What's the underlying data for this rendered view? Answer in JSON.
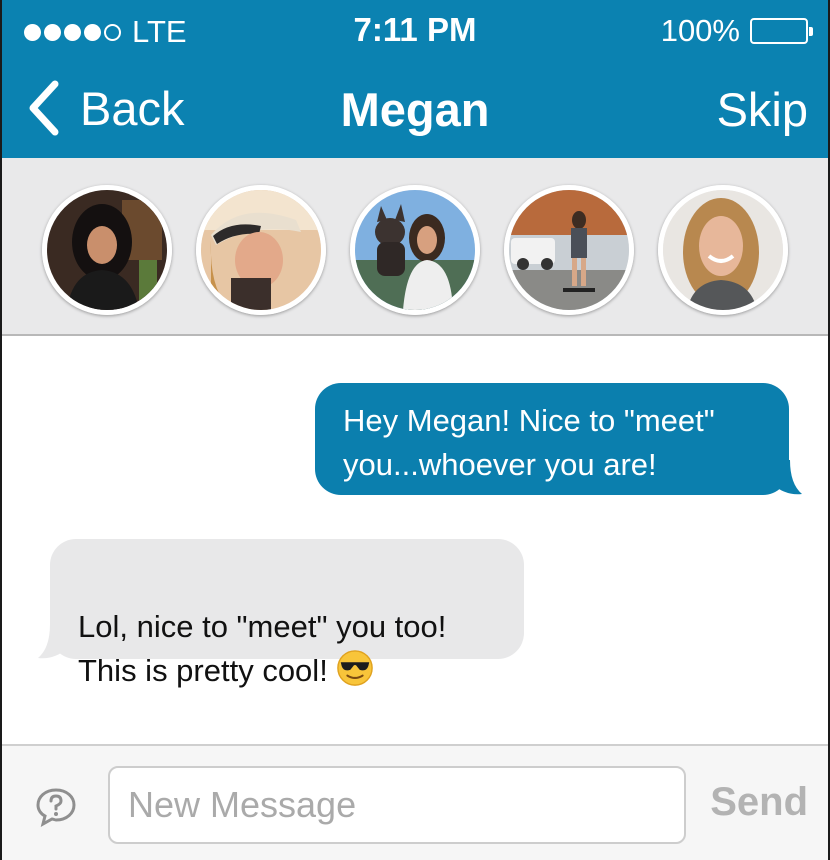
{
  "status_bar": {
    "signal_bars_filled": 4,
    "signal_bars_total": 5,
    "carrier": "LTE",
    "time": "7:11 PM",
    "battery": "100%",
    "battery_level": 1.0
  },
  "nav": {
    "back_label": "Back",
    "title": "Megan",
    "skip_label": "Skip"
  },
  "avatars": [
    {
      "name": "avatar-1"
    },
    {
      "name": "avatar-2"
    },
    {
      "name": "avatar-3"
    },
    {
      "name": "avatar-4"
    },
    {
      "name": "avatar-5"
    }
  ],
  "messages": [
    {
      "direction": "outgoing",
      "text": "Hey Megan! Nice to \"meet\"\nyou...whoever you are!"
    },
    {
      "direction": "incoming",
      "text": "Lol, nice to \"meet\" you too!\nThis is pretty cool!",
      "emoji": "sunglasses-emoji"
    }
  ],
  "composer": {
    "placeholder": "New Message",
    "value": "",
    "send_label": "Send",
    "icon": "chat-bubble-question-icon"
  },
  "colors": {
    "accent": "#0b82b1",
    "outgoing_bubble": "#0b7fae",
    "incoming_bubble": "#e8e8e9",
    "strip_bg": "#e9e9ea",
    "send_disabled": "#b3b3b3"
  }
}
